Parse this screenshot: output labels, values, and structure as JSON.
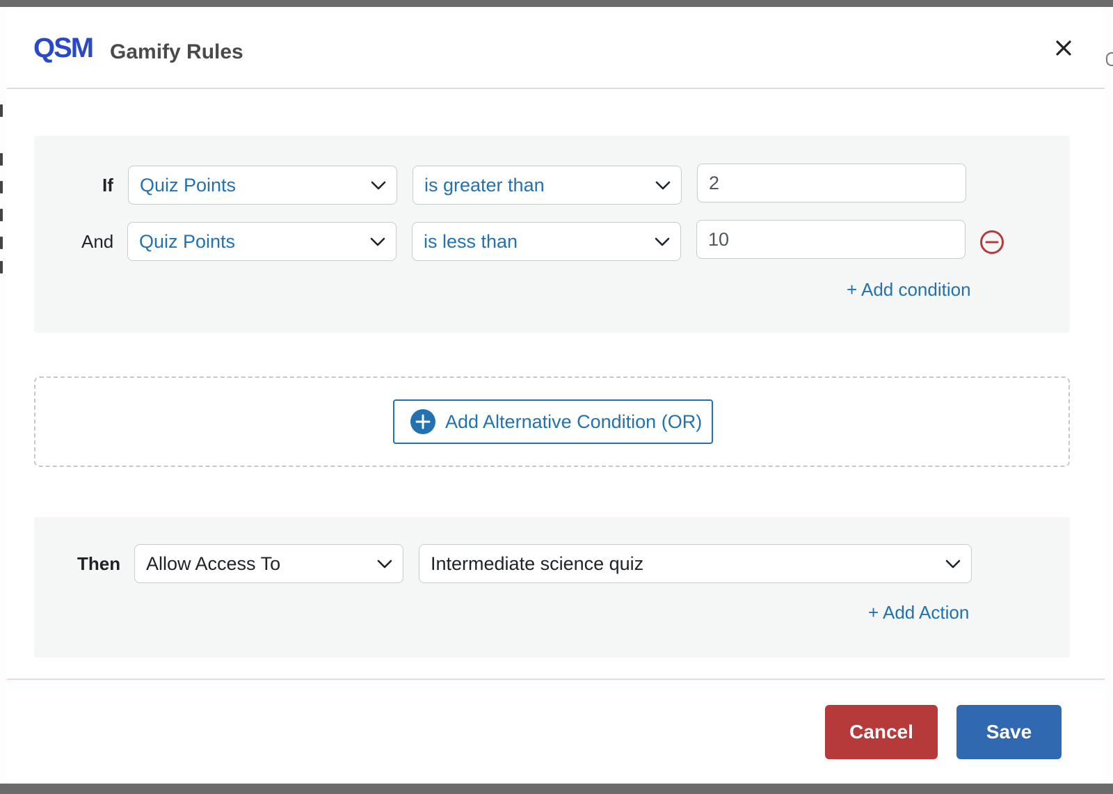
{
  "modal": {
    "logo_text": "QSM",
    "title": "Gamify Rules"
  },
  "conditions": {
    "rows": [
      {
        "connector": "If",
        "field": "Quiz Points",
        "operator": "is greater than",
        "value": "2"
      },
      {
        "connector": "And",
        "field": "Quiz Points",
        "operator": "is less than",
        "value": "10"
      }
    ],
    "add_condition_label": "+ Add condition"
  },
  "alternative": {
    "button_label": "Add Alternative Condition (OR)"
  },
  "actions": {
    "label": "Then",
    "action_type": "Allow Access To",
    "target": "Intermediate science quiz",
    "add_action_label": "+ Add Action"
  },
  "footer": {
    "cancel_label": "Cancel",
    "save_label": "Save"
  },
  "colors": {
    "accent": "#2271b1",
    "danger": "#b73a3a",
    "primary": "#3169b0",
    "logo": "#2a49c9"
  }
}
